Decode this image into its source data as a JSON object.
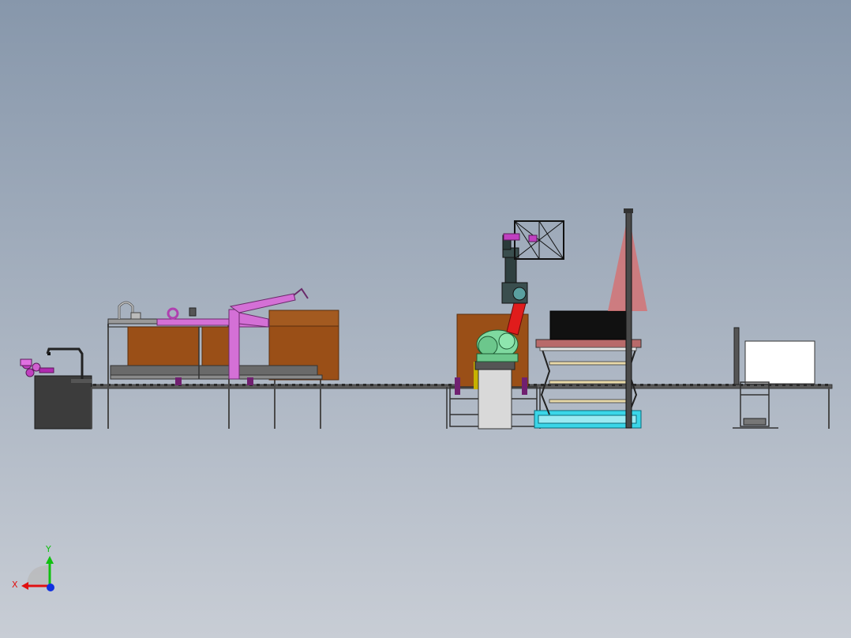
{
  "viewport": {
    "background_top": "#8797ab",
    "background_bottom": "#c8cdd5"
  },
  "colors": {
    "frame": "#4a4a4a",
    "wood": "#9a4f17",
    "wood_edge": "#5a2e0c",
    "pink": "#d470d6",
    "magenta": "#b02bb0",
    "robot_green": "#7fd9a0",
    "robot_red": "#e01c1c",
    "dark_block": "#3c3c3c",
    "cyan_base": "#3ad6e8",
    "cone_red": "#d96b6b",
    "cabinet": "#d9d9d9",
    "screen": "#ffffff"
  },
  "triad": {
    "x_label": "X",
    "y_label": "Y",
    "x_color": "#e01010",
    "y_color": "#10c010",
    "z_color": "#1030e0"
  }
}
